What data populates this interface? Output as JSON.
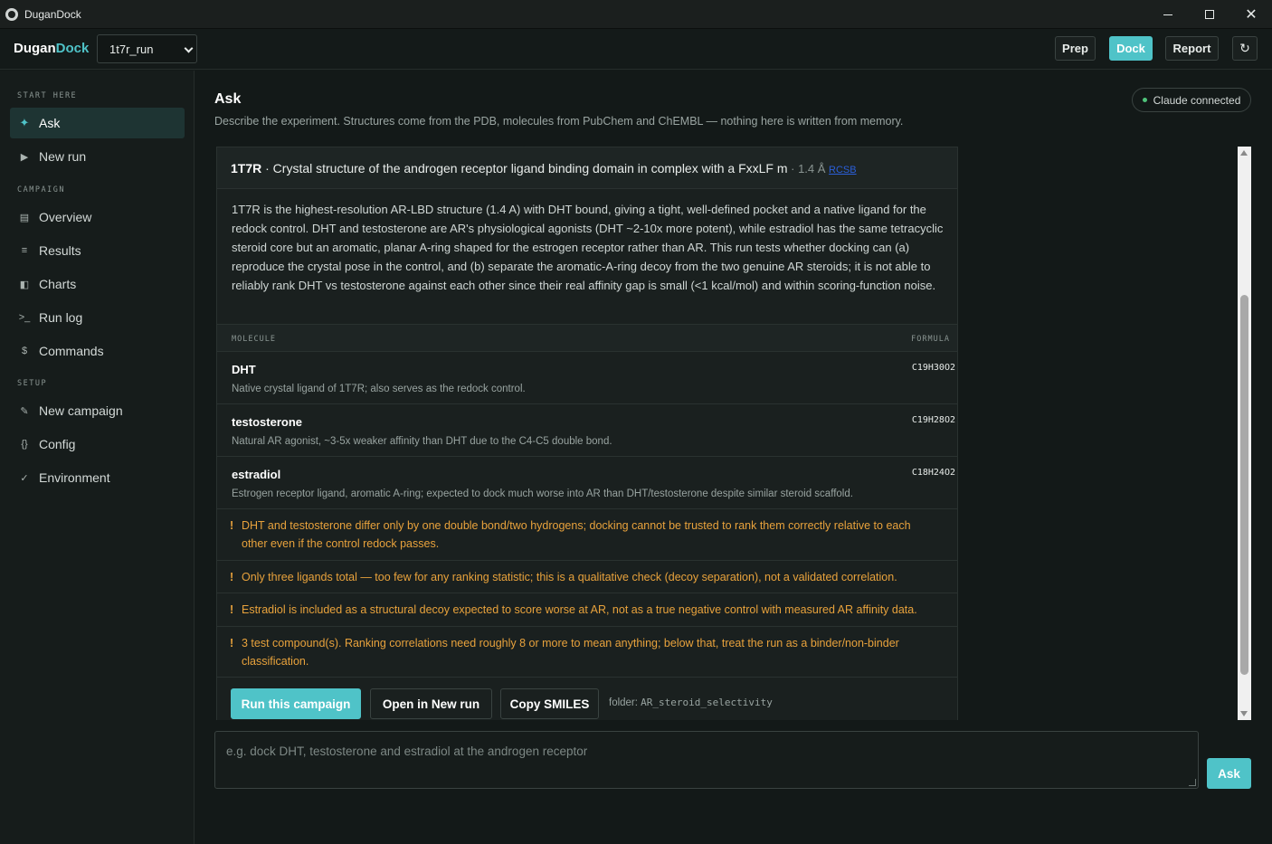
{
  "window": {
    "title": "DuganDock",
    "minimize_icon": "minimize-icon",
    "maximize_icon": "maximize-icon",
    "close_icon": "close-icon"
  },
  "header": {
    "brand_main": "Dugan",
    "brand_accent": "Dock",
    "run_select": "1t7r_run",
    "buttons": {
      "prep": "Prep",
      "dock": "Dock",
      "report": "Report",
      "refresh": "↻"
    },
    "accent_color": "#4fc3c8"
  },
  "sidebar": {
    "sections": {
      "start_here": "START HERE",
      "campaign": "CAMPAIGN",
      "setup": "SETUP"
    },
    "items": [
      {
        "label": "Ask",
        "icon": "✦",
        "icon_name": "sparkle-icon"
      },
      {
        "label": "New run",
        "icon": "▶",
        "icon_name": "play-icon"
      },
      {
        "label": "Overview",
        "icon": "▤",
        "icon_name": "overview-icon"
      },
      {
        "label": "Results",
        "icon": "≡",
        "icon_name": "list-icon"
      },
      {
        "label": "Charts",
        "icon": "◧",
        "icon_name": "chart-icon"
      },
      {
        "label": "Run log",
        "icon": ">_",
        "icon_name": "terminal-icon"
      },
      {
        "label": "Commands",
        "icon": "$",
        "icon_name": "dollar-icon"
      },
      {
        "label": "New campaign",
        "icon": "✎",
        "icon_name": "pencil-icon"
      },
      {
        "label": "Config",
        "icon": "{}",
        "icon_name": "braces-icon"
      },
      {
        "label": "Environment",
        "icon": "✓",
        "icon_name": "check-icon"
      }
    ]
  },
  "main": {
    "title": "Ask",
    "subtitle": "Describe the experiment. Structures come from the PDB, molecules from PubChem and ChEMBL — nothing here is written from memory.",
    "status": "Claude connected"
  },
  "card": {
    "pdb_id": "1T7R",
    "struct_title": " · Crystal structure of the androgen receptor ligand binding domain in complex with a FxxLF m",
    "resolution": " · 1.4 Å ",
    "link": "RCSB",
    "description": "1T7R is the highest-resolution AR-LBD structure (1.4 A) with DHT bound, giving a tight, well-defined pocket and a native ligand for the redock control. DHT and testosterone are AR's physiological agonists (DHT ~2-10x more potent), while estradiol has the same tetracyclic steroid core but an aromatic, planar A-ring shaped for the estrogen receptor rather than AR. This run tests whether docking can (a) reproduce the crystal pose in the control, and (b) separate the aromatic-A-ring decoy from the two genuine AR steroids; it is not able to reliably rank DHT vs testosterone against each other since their real affinity gap is small (<1 kcal/mol) and within scoring-function noise.",
    "table_headers": {
      "molecule": "MOLECULE",
      "formula": "FORMULA"
    },
    "molecules": [
      {
        "name": "DHT",
        "note": "Native crystal ligand of 1T7R; also serves as the redock control.",
        "formula": "C19H30O2"
      },
      {
        "name": "testosterone",
        "note": "Natural AR agonist, ~3-5x weaker affinity than DHT due to the C4-C5 double bond.",
        "formula": "C19H28O2"
      },
      {
        "name": "estradiol",
        "note": "Estrogen receptor ligand, aromatic A-ring; expected to dock much worse into AR than DHT/testosterone despite similar steroid scaffold.",
        "formula": "C18H24O2"
      }
    ],
    "warning_mark": "!",
    "warnings": [
      "DHT and testosterone differ only by one double bond/two hydrogens; docking cannot be trusted to rank them correctly relative to each other even if the control redock passes.",
      "Only three ligands total — too few for any ranking statistic; this is a qualitative check (decoy separation), not a validated correlation.",
      "Estradiol is included as a structural decoy expected to score worse at AR, not as a true negative control with measured AR affinity data.",
      "3 test compound(s). Ranking correlations need roughly 8 or more to mean anything; below that, treat the run as a binder/non-binder classification."
    ],
    "actions": {
      "run": "Run this campaign",
      "open": "Open in New run",
      "copy": "Copy SMILES"
    },
    "folder_label": "folder: ",
    "folder_value": "AR_steroid_selectivity"
  },
  "ask": {
    "placeholder": "e.g. dock DHT, testosterone and estradiol at the androgen receptor",
    "button": "Ask"
  }
}
